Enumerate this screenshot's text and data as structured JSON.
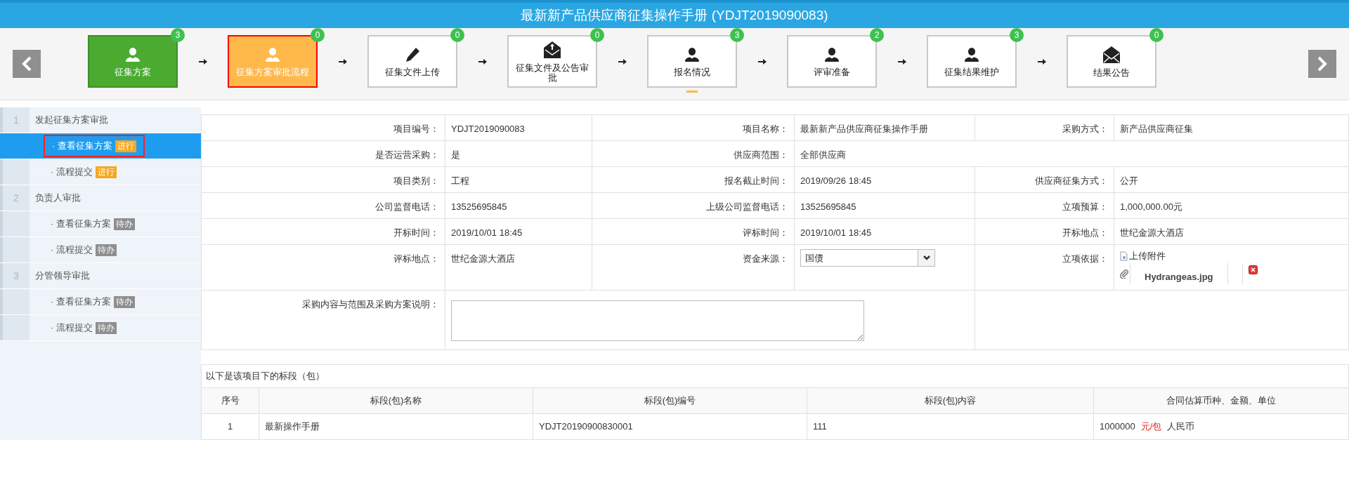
{
  "title": "最新新产品供应商征集操作手册 (YDJT2019090083)",
  "steps": [
    {
      "label": "征集方案",
      "count": "3",
      "completed": true,
      "current": false,
      "kind": "user",
      "selected": false
    },
    {
      "label": "征集方案审批流程",
      "count": "0",
      "completed": false,
      "current": true,
      "kind": "user",
      "selected": false
    },
    {
      "label": "征集文件上传",
      "count": "0",
      "completed": false,
      "current": false,
      "kind": "pencil",
      "selected": false
    },
    {
      "label": "征集文件及公告审批",
      "count": "0",
      "completed": false,
      "current": false,
      "kind": "upload",
      "selected": false
    },
    {
      "label": "报名情况",
      "count": "3",
      "completed": false,
      "current": false,
      "kind": "user",
      "selected": true
    },
    {
      "label": "评审准备",
      "count": "2",
      "completed": false,
      "current": false,
      "kind": "user",
      "selected": false
    },
    {
      "label": "征集结果维护",
      "count": "3",
      "completed": false,
      "current": false,
      "kind": "user",
      "selected": false
    },
    {
      "label": "结果公告",
      "count": "0",
      "completed": false,
      "current": false,
      "kind": "mail",
      "selected": false
    }
  ],
  "sidebar": [
    {
      "number": "1",
      "title": "发起征集方案审批",
      "items": [
        {
          "label": "· 查看征集方案",
          "badge": "进行",
          "active": true,
          "selected": true
        },
        {
          "label": "· 流程提交",
          "badge": "进行",
          "active": true,
          "selected": false
        }
      ]
    },
    {
      "number": "2",
      "title": "负责人审批",
      "items": [
        {
          "label": "· 查看征集方案",
          "badge": "待办",
          "active": false,
          "selected": false
        },
        {
          "label": "· 流程提交",
          "badge": "待办",
          "active": false,
          "selected": false
        }
      ]
    },
    {
      "number": "3",
      "title": "分管领导审批",
      "items": [
        {
          "label": "· 查看征集方案",
          "badge": "待办",
          "active": false,
          "selected": false
        },
        {
          "label": "· 流程提交",
          "badge": "待办",
          "active": false,
          "selected": false
        }
      ]
    }
  ],
  "form": [
    [
      {
        "label": "项目编号：",
        "kind": "text",
        "value": "YDJT2019090083"
      },
      {
        "label": "项目名称：",
        "kind": "text",
        "value": "最新新产品供应商征集操作手册"
      },
      {
        "label": "采购方式：",
        "kind": "text",
        "value": "新产品供应商征集"
      }
    ],
    [
      {
        "label": "是否运营采购：",
        "kind": "text",
        "value": "是"
      },
      {
        "label": "供应商范围：",
        "kind": "text",
        "value": "全部供应商"
      }
    ],
    [
      {
        "label": "项目类别：",
        "kind": "text",
        "value": "工程"
      },
      {
        "label": "报名截止时间：",
        "kind": "text",
        "value": "2019/09/26 18:45"
      },
      {
        "label": "供应商征集方式：",
        "kind": "text",
        "value": "公开"
      }
    ],
    [
      {
        "label": "公司监督电话：",
        "kind": "text",
        "value": "13525695845"
      },
      {
        "label": "上级公司监督电话：",
        "kind": "text",
        "value": "13525695845"
      },
      {
        "label": "立项预算：",
        "kind": "text",
        "value": "1,000,000.00元"
      }
    ],
    [
      {
        "label": "开标时间：",
        "kind": "text",
        "value": "2019/10/01 18:45"
      },
      {
        "label": "评标时间：",
        "kind": "text",
        "value": "2019/10/01 18:45"
      },
      {
        "label": "开标地点：",
        "kind": "text",
        "value": "世纪金源大酒店"
      }
    ],
    [
      {
        "label": "评标地点：",
        "kind": "text",
        "value": "世纪金源大酒店"
      },
      {
        "label": "资金来源：",
        "kind": "select",
        "value": "国债"
      },
      {
        "label": "立项依据：",
        "kind": "attachment",
        "upload": "上传附件",
        "file": "Hydrangeas.jpg"
      }
    ],
    [
      {
        "label": "采购内容与范围及采购方案说明：",
        "kind": "textarea"
      }
    ]
  ],
  "lots": {
    "caption": "以下是该项目下的标段（包）",
    "columns": [
      "序号",
      "标段(包)名称",
      "标段(包)编号",
      "标段(包)内容",
      "合同估算币种、金额、单位"
    ],
    "rows": [
      {
        "cells": [
          "1",
          "最新操作手册",
          "YDJT20190900830001",
          "111"
        ],
        "amount": "1000000",
        "unit": "元/包",
        "currency": "人民币"
      }
    ]
  }
}
